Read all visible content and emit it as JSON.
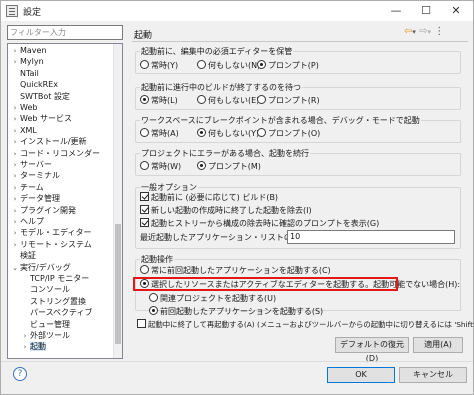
{
  "window": {
    "title": "設定",
    "min_glyph": "—",
    "max_glyph": "☐",
    "close_glyph": "✕"
  },
  "filter": {
    "placeholder": "フィルター入力"
  },
  "tree": [
    {
      "label": "Maven",
      "arrow": "›",
      "indent": 1
    },
    {
      "label": "Mylyn",
      "arrow": "›",
      "indent": 1
    },
    {
      "label": "NTail",
      "arrow": "",
      "indent": 1
    },
    {
      "label": "QuickREx",
      "arrow": "",
      "indent": 1
    },
    {
      "label": "SWTBot 設定",
      "arrow": "",
      "indent": 1
    },
    {
      "label": "Web",
      "arrow": "›",
      "indent": 1
    },
    {
      "label": "Web サービス",
      "arrow": "›",
      "indent": 1
    },
    {
      "label": "XML",
      "arrow": "›",
      "indent": 1
    },
    {
      "label": "インストール/更新",
      "arrow": "›",
      "indent": 1
    },
    {
      "label": "コード・リコメンダー",
      "arrow": "›",
      "indent": 1
    },
    {
      "label": "サーバー",
      "arrow": "›",
      "indent": 1
    },
    {
      "label": "ターミナル",
      "arrow": "›",
      "indent": 1
    },
    {
      "label": "チーム",
      "arrow": "›",
      "indent": 1
    },
    {
      "label": "データ管理",
      "arrow": "›",
      "indent": 1
    },
    {
      "label": "プラグイン開発",
      "arrow": "›",
      "indent": 1
    },
    {
      "label": "ヘルプ",
      "arrow": "›",
      "indent": 1
    },
    {
      "label": "モデル・エディター",
      "arrow": "›",
      "indent": 1
    },
    {
      "label": "リモート・システム",
      "arrow": "›",
      "indent": 1
    },
    {
      "label": "検証",
      "arrow": "",
      "indent": 1
    },
    {
      "label": "実行/デバッグ",
      "arrow": "⌄",
      "indent": 1
    },
    {
      "label": "TCP/IP モニター",
      "arrow": "",
      "indent": 2
    },
    {
      "label": "コンソール",
      "arrow": "",
      "indent": 2
    },
    {
      "label": "ストリング置換",
      "arrow": "",
      "indent": 2
    },
    {
      "label": "パースペクティブ",
      "arrow": "",
      "indent": 2
    },
    {
      "label": "ビュー管理",
      "arrow": "",
      "indent": 2
    },
    {
      "label": "外部ツール",
      "arrow": "›",
      "indent": 2
    },
    {
      "label": "起動",
      "arrow": "›",
      "indent": 2,
      "selected": true
    }
  ],
  "page": {
    "title": "起動",
    "nav_back": "⇦",
    "nav_back_menu": "▾",
    "nav_forward": "⇨",
    "nav_forward_menu": "▾",
    "nav_more": "⋮"
  },
  "groups": {
    "save": {
      "label": "起動前に、編集中の必須エディターを保管",
      "options": [
        "常時(Y)",
        "何もしない(N)",
        "プロンプト(P)"
      ],
      "selected": 2
    },
    "build": {
      "label": "起動前に進行中のビルドが終了するのを待つ",
      "options": [
        "常時(L)",
        "何もしない(E)",
        "プロンプト(R)"
      ],
      "selected": 0
    },
    "debug": {
      "label": "ワークスペースにブレークポイントが含まれる場合、デバッグ・モードで起動",
      "options": [
        "常時(A)",
        "何もしない(Y)",
        "プロンプト(O)"
      ],
      "selected": 1
    },
    "errors": {
      "label": "プロジェクトにエラーがある場合、起動を続行",
      "options": [
        "常時(W)",
        "プロンプト(M)"
      ],
      "selected": 1
    },
    "general": {
      "label": "一般オプション",
      "checks": [
        {
          "label": "起動前に (必要に応じて) ビルド(B)",
          "checked": true
        },
        {
          "label": "新しい起動の作成時に終了した起動を除去(I)",
          "checked": true
        },
        {
          "label": "起動ヒストリーから構成の除去時に確認のプロンプトを表示(G)",
          "checked": true
        }
      ],
      "history_label": "最近起動したアプリケーション・リストのサイズ(Z):",
      "history_value": "10"
    },
    "launch_ops": {
      "label": "起動操作",
      "opt1": "常に前回起動したアプリケーションを起動する(C)",
      "opt2": "選択したリソースまたはアクティブなエディターを起動する。起動可能でない場合(H):",
      "sub1": "関連プロジェクトを起動する(U)",
      "sub2": "前回起動したアプリケーションを起動する(S)",
      "selected": "opt2",
      "sub_selected": "sub2"
    }
  },
  "terminate": {
    "label": "起動中に終了して再起動する(A) (メニューおよびツールバーからの起動中に切り替えるには 'Shift' 押下)",
    "checked": false
  },
  "buttons": {
    "restore": "デフォルトの復元(D)",
    "apply": "適用(A)",
    "ok": "OK",
    "cancel": "キャンセル"
  },
  "help_glyph": "?"
}
